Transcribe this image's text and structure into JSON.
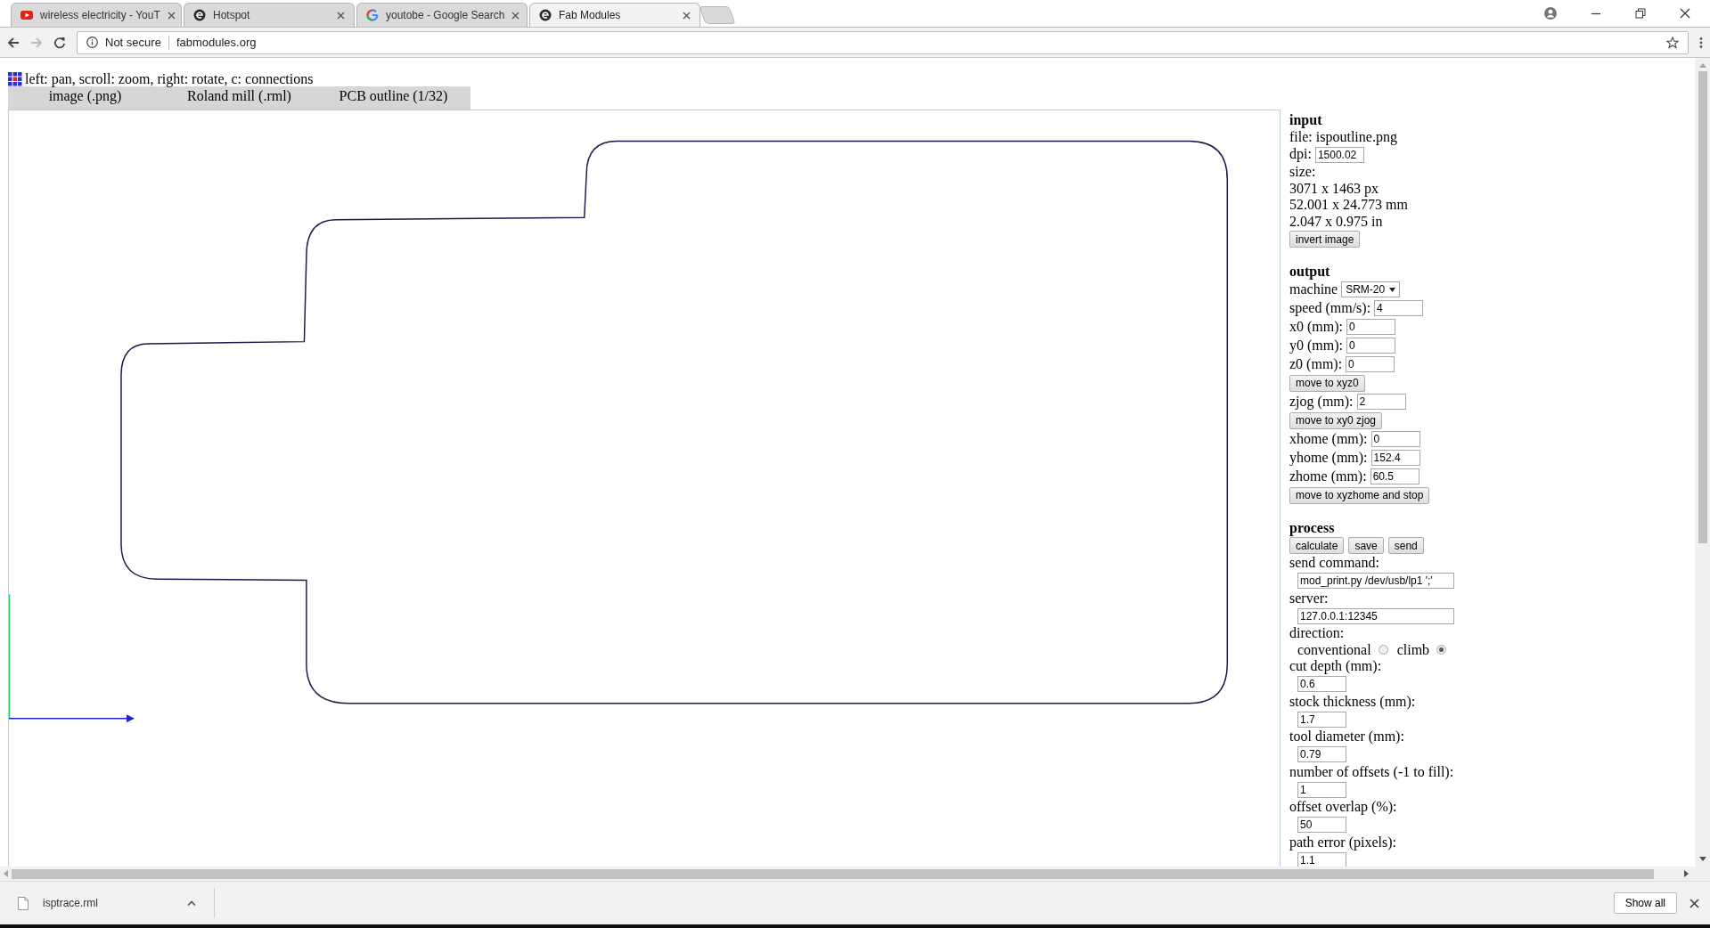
{
  "tabs": [
    {
      "title": "wireless electricity - YouT",
      "kind": "video",
      "selected": false
    },
    {
      "title": "Hotspot",
      "kind": "site",
      "selected": false
    },
    {
      "title": "youtobe - Google Search",
      "kind": "search-engine",
      "selected": false
    },
    {
      "title": "Fab Modules",
      "kind": "site",
      "selected": true
    }
  ],
  "address": {
    "security": "Not secure",
    "url": "fabmodules.org"
  },
  "hint": "left: pan, scroll: zoom, right: rotate, c: connections",
  "menu": [
    "image (.png)",
    "Roland mill (.rml)",
    "PCB outline (1/32)"
  ],
  "panel": [
    {
      "heading": "input",
      "rows": [
        {
          "kind": "text",
          "text": "file: ispoutline.png"
        },
        {
          "kind": "field",
          "label": "dpi:",
          "value": "1500.02"
        },
        {
          "kind": "text",
          "text": "size:"
        },
        {
          "kind": "text",
          "text": "3071 x 1463 px"
        },
        {
          "kind": "text",
          "text": "52.001 x 24.773 mm"
        },
        {
          "kind": "text",
          "text": "2.047 x 0.975 in"
        },
        {
          "kind": "button",
          "label": "invert image"
        }
      ]
    },
    {
      "heading": "output",
      "rows": [
        {
          "kind": "select",
          "label": "machine",
          "value": "SRM-20"
        },
        {
          "kind": "field",
          "label": "speed (mm/s):",
          "value": "4"
        },
        {
          "kind": "field",
          "label": "x0 (mm):",
          "value": "0"
        },
        {
          "kind": "field",
          "label": "y0 (mm):",
          "value": "0"
        },
        {
          "kind": "field",
          "label": "z0 (mm):",
          "value": "0"
        },
        {
          "kind": "button",
          "label": "move to xyz0"
        },
        {
          "kind": "field",
          "label": "zjog (mm):",
          "value": "2"
        },
        {
          "kind": "button",
          "label": "move to xy0 zjog"
        },
        {
          "kind": "field",
          "label": "xhome (mm):",
          "value": "0"
        },
        {
          "kind": "field",
          "label": "yhome (mm):",
          "value": "152.4"
        },
        {
          "kind": "field",
          "label": "zhome (mm):",
          "value": "60.5"
        },
        {
          "kind": "button",
          "label": "move to xyzhome and stop"
        }
      ]
    },
    {
      "heading": "process",
      "rows": [
        {
          "kind": "buttons",
          "labels": [
            "calculate",
            "save",
            "send"
          ]
        },
        {
          "kind": "text",
          "text": "send command:"
        },
        {
          "kind": "wide-field",
          "value": "mod_print.py /dev/usb/lp1 ';'"
        },
        {
          "kind": "text",
          "text": "server:"
        },
        {
          "kind": "wide-field",
          "value": "127.0.0.1:12345"
        },
        {
          "kind": "text",
          "text": "direction:"
        },
        {
          "kind": "radio",
          "options": [
            {
              "label": "conventional",
              "selected": false
            },
            {
              "label": "climb",
              "selected": true
            }
          ]
        },
        {
          "kind": "text",
          "text": "cut depth (mm):"
        },
        {
          "kind": "short-field",
          "value": "0.6"
        },
        {
          "kind": "text",
          "text": "stock thickness (mm):"
        },
        {
          "kind": "short-field",
          "value": "1.7"
        },
        {
          "kind": "text",
          "text": "tool diameter (mm):"
        },
        {
          "kind": "short-field",
          "value": "0.79"
        },
        {
          "kind": "text",
          "text": "number of offsets (-1 to fill):"
        },
        {
          "kind": "short-field",
          "value": "1"
        },
        {
          "kind": "text",
          "text": "offset overlap (%):"
        },
        {
          "kind": "short-field",
          "value": "50"
        },
        {
          "kind": "text",
          "text": "path error (pixels):"
        },
        {
          "kind": "short-field",
          "value": "1.1"
        }
      ]
    }
  ],
  "downloads": {
    "file": "isptrace.rml",
    "button": "Show all"
  }
}
